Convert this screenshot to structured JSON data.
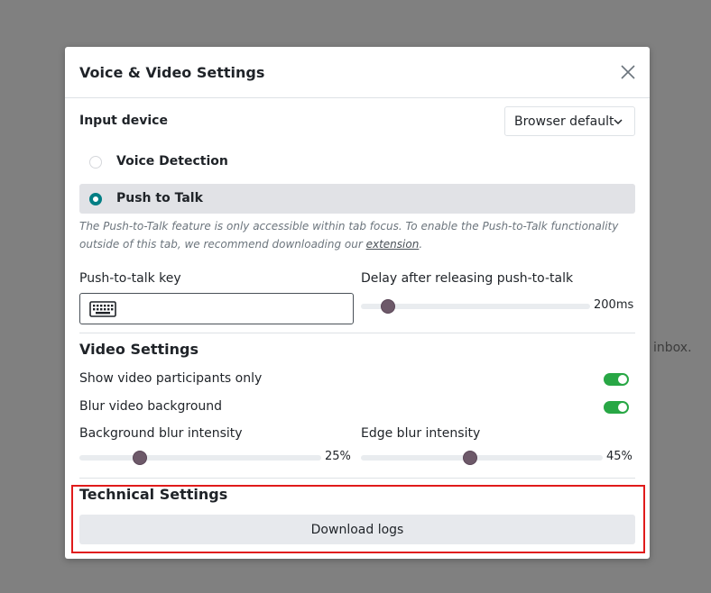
{
  "background": {
    "partial_text": "inbox."
  },
  "modal": {
    "title": "Voice & Video Settings",
    "close_icon": "close-icon"
  },
  "input_device": {
    "label": "Input device",
    "selected": "Browser default"
  },
  "modes": [
    {
      "label": "Voice Detection",
      "checked": false
    },
    {
      "label": "Push to Talk",
      "checked": true
    }
  ],
  "help": {
    "text_before": "The Push-to-Talk feature is only accessible within tab focus. To enable the Push-to-Talk functionality outside of this tab, we recommend downloading our ",
    "link": "extension",
    "text_after": "."
  },
  "ptt": {
    "key_label": "Push-to-talk key",
    "delay_label": "Delay after releasing push-to-talk",
    "delay_value": "200ms",
    "delay_fraction": 0.12
  },
  "video": {
    "title": "Video Settings",
    "show_participants_label": "Show video participants only",
    "show_participants_on": true,
    "blur_bg_label": "Blur video background",
    "blur_bg_on": true,
    "bg_blur_label": "Background blur intensity",
    "bg_blur_value": "25%",
    "bg_blur_fraction": 0.25,
    "edge_blur_label": "Edge blur intensity",
    "edge_blur_value": "45%",
    "edge_blur_fraction": 0.45
  },
  "technical": {
    "title": "Technical Settings",
    "download_label": "Download logs"
  },
  "colors": {
    "accent": "#017e84",
    "toggle_on": "#28a745",
    "highlight": "#e01b1b"
  }
}
